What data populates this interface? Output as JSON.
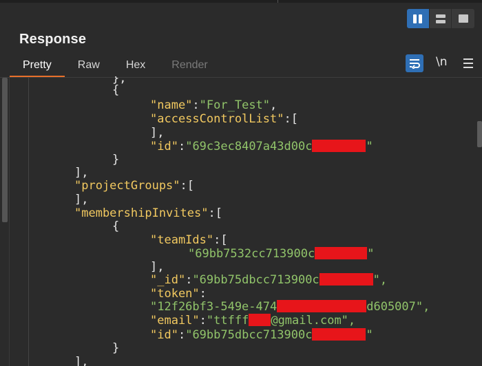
{
  "view_toggles": [
    {
      "icon": "columns-icon",
      "active": true
    },
    {
      "icon": "rows-icon",
      "active": false
    },
    {
      "icon": "single-panel-icon",
      "active": false
    }
  ],
  "panel": {
    "title": "Response",
    "tabs": [
      {
        "label": "Pretty",
        "active": true
      },
      {
        "label": "Raw",
        "active": false
      },
      {
        "label": "Hex",
        "active": false
      },
      {
        "label": "Render",
        "disabled": true
      }
    ],
    "toolbar": {
      "wrap_icon": "word-wrap-icon",
      "newline_label": "\\n",
      "menu_icon": "hamburger-menu-icon"
    }
  },
  "colors": {
    "accent": "#2f6fb5",
    "tab_underline": "#e8702a",
    "json_key": "#f2c960",
    "json_string": "#91c46a",
    "redaction": "#e7151a",
    "background": "#2b2b2b"
  },
  "code": {
    "l1": "},",
    "l2": "{",
    "l3k": "\"name\"",
    "l3s": "\"For_Test\"",
    "l4k": "\"accessControlList\"",
    "l5": "],",
    "l6k": "\"id\"",
    "l6s": "\"69c3ec8407a43d00c",
    "l6e": "\"",
    "l7": "}",
    "l8": "],",
    "l9k": "\"projectGroups\"",
    "l10": "],",
    "l11k": "\"membershipInvites\"",
    "l12": "{",
    "l13k": "\"teamIds\"",
    "l14s": "\"69bb7532cc713900c",
    "l14e": "\"",
    "l15": "],",
    "l16k": "\"_id\"",
    "l16s": "\"69bb75dbcc713900c",
    "l16e": "\",",
    "l17k": "\"token\"",
    "l18s": "\"12f26bf3-549e-474",
    "l18e": "d605007\",",
    "l19k": "\"email\"",
    "l19s": "\"ttfff",
    "l19e": "@gmail.com\",",
    "l20k": "\"id\"",
    "l20s": "\"69bb75dbcc713900c",
    "l20e": "\"",
    "l21": "}",
    "l22": "],"
  }
}
